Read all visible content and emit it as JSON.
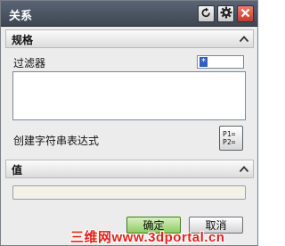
{
  "dialog": {
    "title": "关系",
    "title_buttons": [
      {
        "icon": "reset-icon"
      },
      {
        "icon": "gear-icon"
      },
      {
        "icon": "close-icon"
      }
    ]
  },
  "spec_section": {
    "title": "规格",
    "filter_label": "过滤器",
    "filter_value": "*",
    "create_expression_label": "创建字符串表达式",
    "expression_button_text": "P1=\nP2="
  },
  "value_section": {
    "title": "值",
    "value": ""
  },
  "footer": {
    "ok_label": "确定",
    "cancel_label": "取消"
  },
  "watermark": "三维网www.3dportal.cn",
  "colors": {
    "titlebar": "#4a5361",
    "ok_button": "#8ecb62",
    "close_button": "#c63a26",
    "watermark": "#e2231a"
  }
}
